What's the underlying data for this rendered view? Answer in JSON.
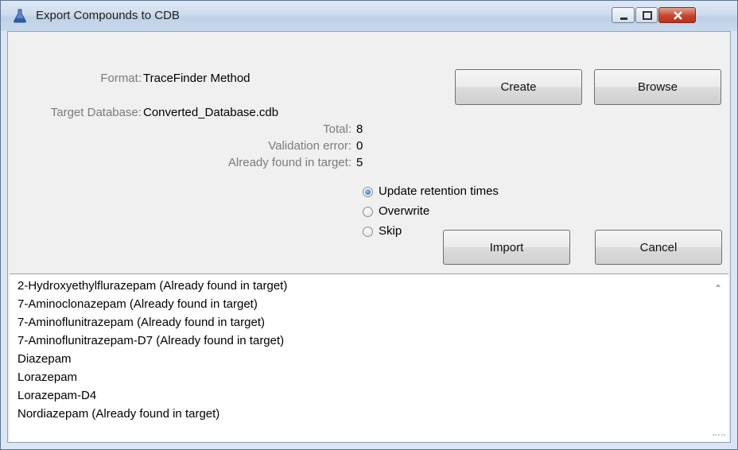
{
  "window": {
    "title": "Export Compounds to CDB"
  },
  "form": {
    "format_label": "Format:",
    "format_value": "TraceFinder Method",
    "target_label": "Target Database:",
    "target_value": "Converted_Database.cdb",
    "total_label": "Total:",
    "total_value": "8",
    "validation_label": "Validation error:",
    "validation_value": "0",
    "found_label": "Already found in target:",
    "found_value": "5"
  },
  "buttons": {
    "create": "Create",
    "browse": "Browse",
    "import": "Import",
    "cancel": "Cancel"
  },
  "options": [
    {
      "label": "Update retention times",
      "checked": true
    },
    {
      "label": "Overwrite",
      "checked": false
    },
    {
      "label": "Skip",
      "checked": false
    }
  ],
  "compounds": [
    "2-Hydroxyethylflurazepam  (Already found in target)",
    "7-Aminoclonazepam  (Already found in target)",
    "7-Aminoflunitrazepam  (Already found in target)",
    "7-Aminoflunitrazepam-D7  (Already found in target)",
    "Diazepam",
    "Lorazepam",
    "Lorazepam-D4",
    "Nordiazepam  (Already found in target)"
  ],
  "colors": {
    "label_gray": "#7b7b7b",
    "radio_accent": "#1f6cc1",
    "close_red": "#c9442c"
  },
  "icons": {
    "app": "flask-icon",
    "minimize": "minimize-icon",
    "maximize": "maximize-icon",
    "close": "close-icon"
  }
}
